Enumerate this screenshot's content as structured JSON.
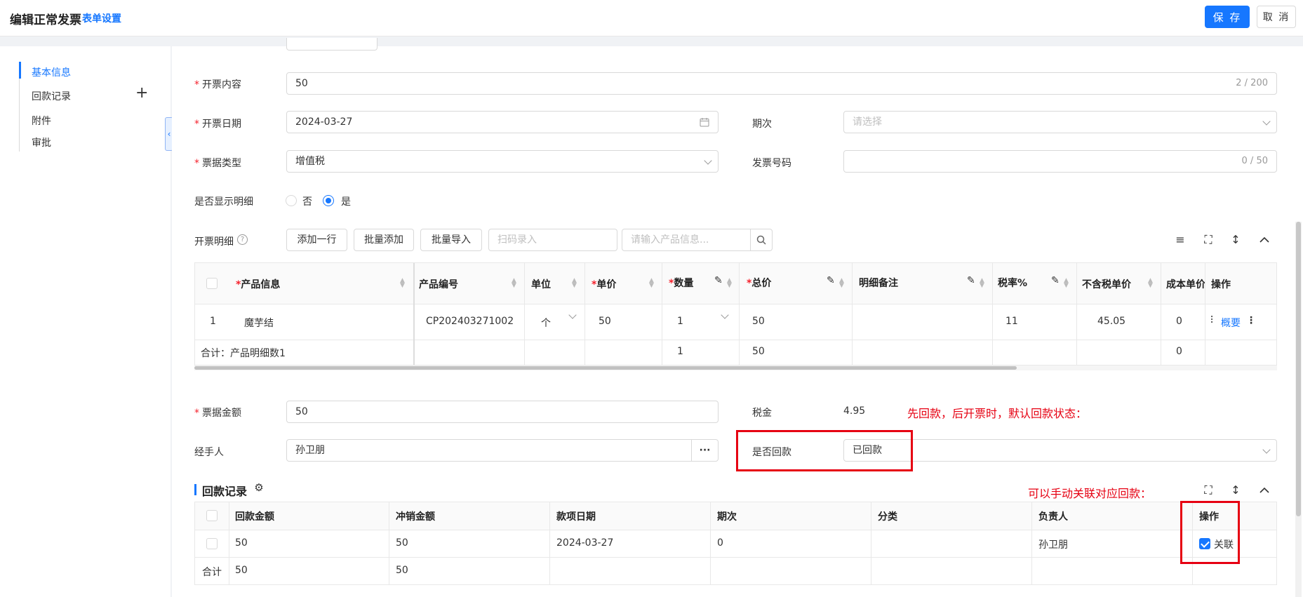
{
  "header": {
    "title": "编辑正常发票",
    "form_settings": "表单设置",
    "save": "保 存",
    "cancel": "取 消"
  },
  "nav": {
    "items": [
      "基本信息",
      "回款记录",
      "附件",
      "审批"
    ],
    "plus": "+"
  },
  "form": {
    "content_label": "开票内容",
    "content_value": "50",
    "content_count": "2 / 200",
    "date_label": "开票日期",
    "date_value": "2024-03-27",
    "period_label": "期次",
    "period_placeholder": "请选择",
    "type_label": "票据类型",
    "type_value": "增值税",
    "invoice_no_label": "发票号码",
    "invoice_no_count": "0 / 50",
    "show_detail_label": "是否显示明细",
    "show_no": "否",
    "show_yes": "是",
    "detail_label": "开票明细",
    "add_row": "添加一行",
    "batch_add": "批量添加",
    "batch_import": "批量导入",
    "scan_placeholder": "扫码录入",
    "product_search_placeholder": "请输入产品信息...",
    "amount_label": "票据金额",
    "amount_value": "50",
    "tax_label": "税金",
    "tax_value": "4.95",
    "handler_label": "经手人",
    "handler_value": "孙卫朋",
    "handler_more": "···",
    "paid_label": "是否回款",
    "paid_value": "已回款"
  },
  "detail_table": {
    "headers": [
      "产品信息",
      "产品编号",
      "单位",
      "单价",
      "数量",
      "总价",
      "明细备注",
      "税率%",
      "不含税单价",
      "成本单价",
      "操作"
    ],
    "row": {
      "index": "1",
      "product": "魔芋结",
      "code": "CP202403271002",
      "unit": "个",
      "price": "50",
      "qty": "1",
      "total": "50",
      "remark": "",
      "tax_rate": "11",
      "net_price": "45.05",
      "cost": "0",
      "action": "概要"
    },
    "summary": {
      "label": "合计：产品明细数1",
      "qty": "1",
      "total": "50",
      "cost": "0"
    }
  },
  "payment": {
    "title": "回款记录",
    "headers": [
      "回款金额",
      "冲销金额",
      "款项日期",
      "期次",
      "分类",
      "负责人",
      "操作"
    ],
    "row": {
      "amount": "50",
      "offset": "50",
      "date": "2024-03-27",
      "period": "0",
      "category": "",
      "owner": "孙卫朋",
      "action": "关联"
    },
    "summary": {
      "label": "合计",
      "amount": "50",
      "offset": "50"
    }
  },
  "annotations": {
    "note1": "先回款，后开票时，默认回款状态：",
    "note2": "可以手动关联对应回款："
  },
  "colors": {
    "accent": "#1677ff",
    "annotation": "#e60012"
  }
}
